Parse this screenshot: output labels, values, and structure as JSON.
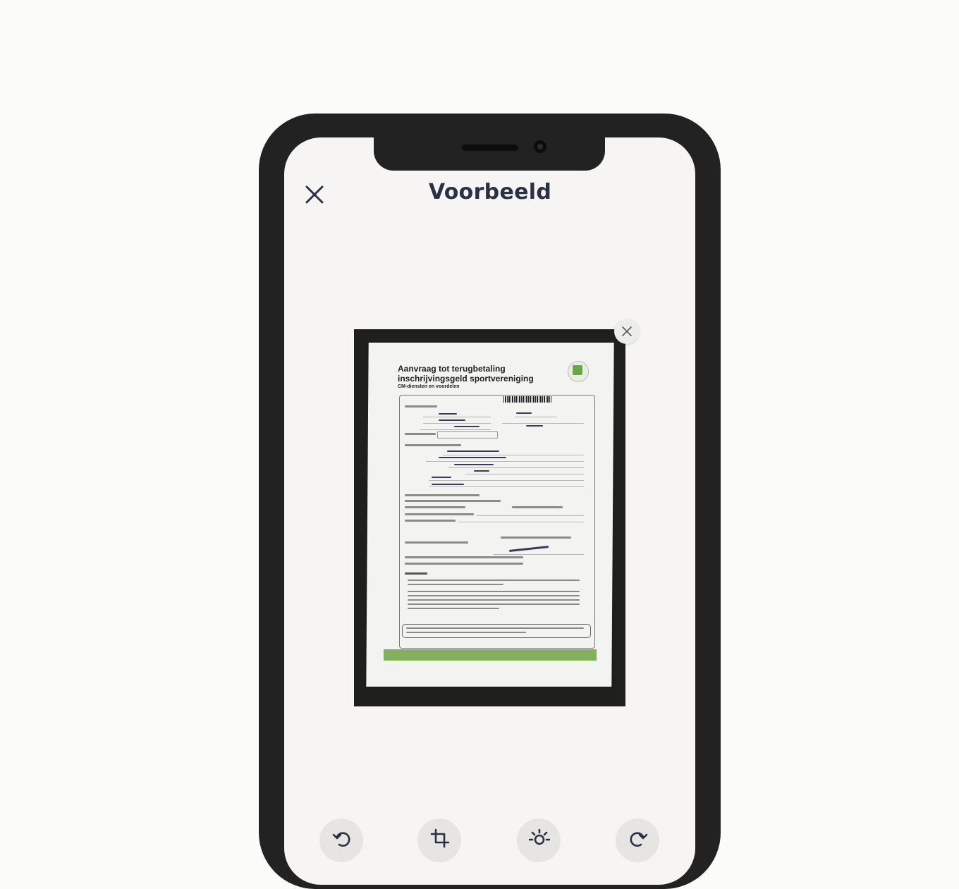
{
  "header": {
    "title": "Voorbeeld",
    "close_icon": "close-icon"
  },
  "preview": {
    "document_title": "Aanvraag tot terugbetaling inschrijvingsgeld sportvereniging",
    "document_subtitle": "CM-diensten en voordelen",
    "remove_icon": "close-icon"
  },
  "toolbar": {
    "items": [
      {
        "icon": "rotate-left-icon"
      },
      {
        "icon": "crop-icon"
      },
      {
        "icon": "brightness-icon"
      },
      {
        "icon": "rotate-right-icon"
      }
    ]
  },
  "colors": {
    "title": "#2b3144",
    "screen": "#f6f5f3",
    "phone_frame": "#222222",
    "form_accent": "#84b05c"
  }
}
